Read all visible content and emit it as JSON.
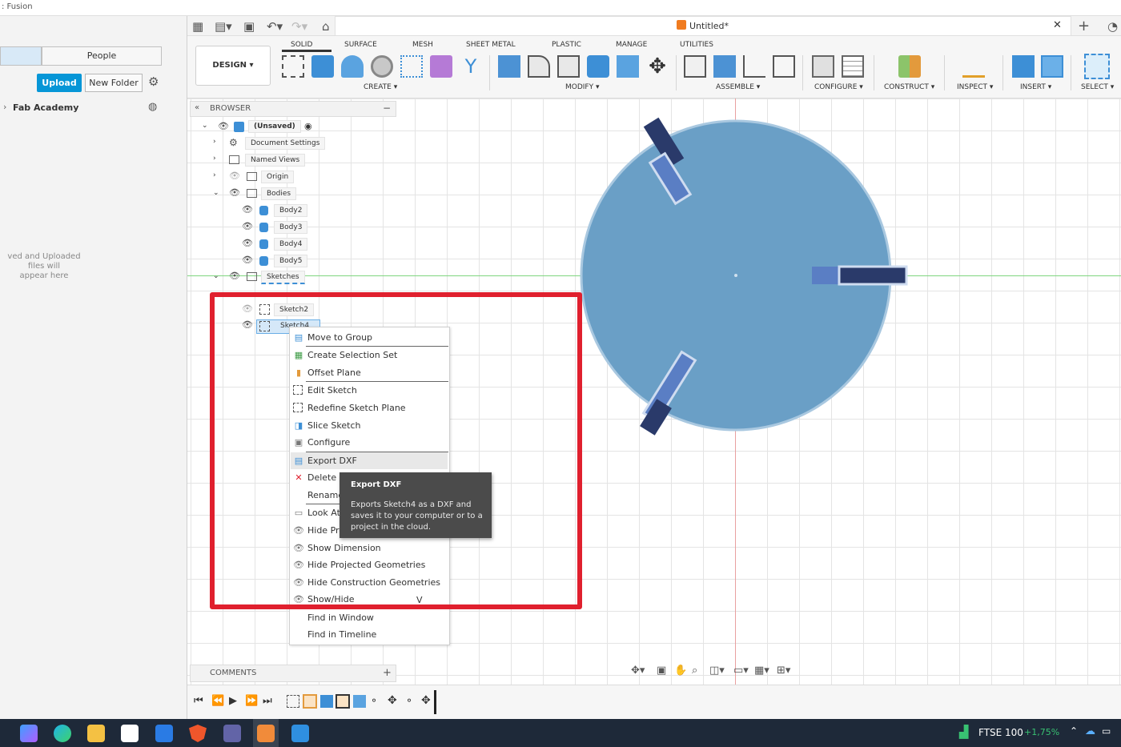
{
  "app": {
    "title": ": Fusion",
    "doc_title": "Untitled*"
  },
  "data_panel": {
    "tab_people": "People",
    "upload": "Upload",
    "new_folder": "New Folder",
    "project": "Fab Academy",
    "empty_line1": "ved and Uploaded files will",
    "empty_line2": "appear here"
  },
  "toolbar": {
    "design": "DESIGN",
    "tabs": [
      "SOLID",
      "SURFACE",
      "MESH",
      "SHEET METAL",
      "PLASTIC",
      "MANAGE",
      "UTILITIES"
    ],
    "groups": [
      "CREATE",
      "MODIFY",
      "ASSEMBLE",
      "CONFIGURE",
      "CONSTRUCT",
      "INSPECT",
      "INSERT",
      "SELECT"
    ]
  },
  "browser": {
    "title": "BROWSER",
    "root": "(Unsaved)",
    "document_settings": "Document Settings",
    "named_views": "Named Views",
    "origin": "Origin",
    "bodies": "Bodies",
    "body_items": [
      "Body2",
      "Body3",
      "Body4",
      "Body5"
    ],
    "sketches": "Sketches",
    "sketch2": "Sketch2",
    "sketch4": "Sketch4"
  },
  "context_menu": {
    "items": [
      "Move to Group",
      "Create Selection Set",
      "Offset Plane",
      "Edit Sketch",
      "Redefine Sketch Plane",
      "Slice Sketch",
      "Configure",
      "Export DXF",
      "Delete",
      "Rename",
      "Look At",
      "Hide Pro",
      "Show Dimension",
      "Hide Projected Geometries",
      "Hide Construction Geometries",
      "Show/Hide",
      "Find in Window",
      "Find in Timeline"
    ],
    "show_hide_shortcut": "V"
  },
  "tooltip": {
    "title": "Export DXF",
    "body": "Exports Sketch4 as a DXF and saves it to your computer or to a project in the cloud."
  },
  "comments": {
    "label": "COMMENTS",
    "add": "+"
  },
  "taskbar": {
    "ftse_label": "FTSE 100",
    "ftse_change": "+1,75%"
  },
  "colors": {
    "accent": "#0696d7",
    "highlight": "#e0202e",
    "disc": "#6a9fc6",
    "taskbar": "#1e2939"
  }
}
